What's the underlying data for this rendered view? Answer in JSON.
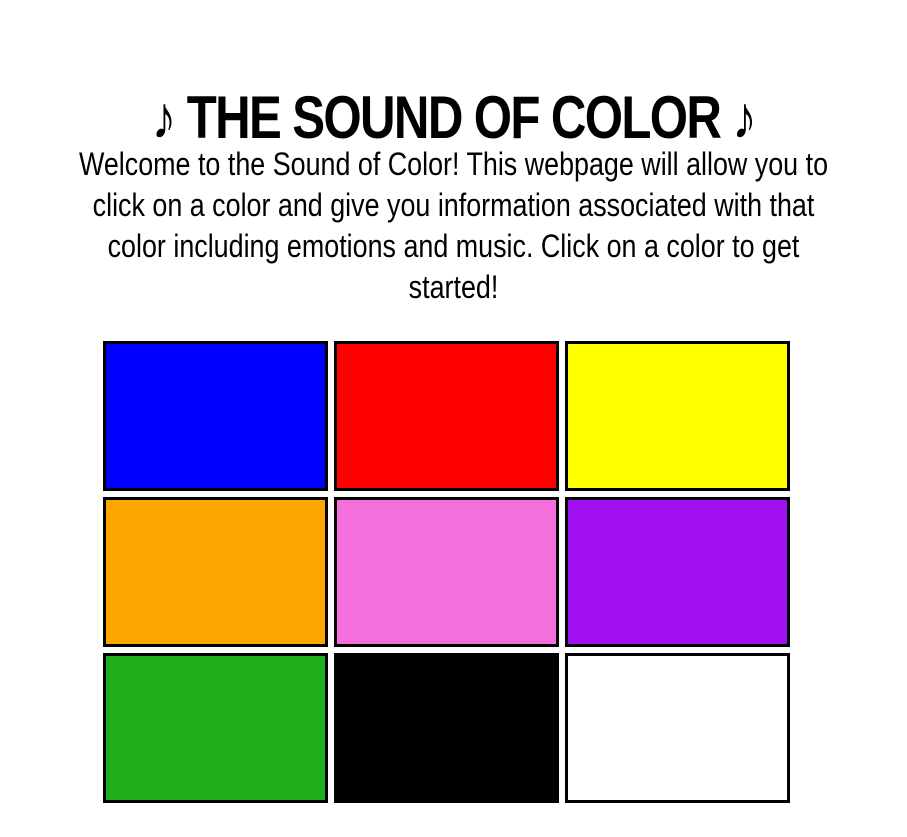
{
  "header": {
    "title": "♪ THE SOUND OF COLOR ♪"
  },
  "intro": {
    "text": "Welcome to the Sound of Color! This webpage will allow you to click on a color and give you information associated with that color including emotions and music. Click on a color to get started!"
  },
  "swatches": [
    {
      "color": "#0000ff"
    },
    {
      "color": "#ff0000"
    },
    {
      "color": "#ffff00"
    },
    {
      "color": "#ffa500"
    },
    {
      "color": "#f56fdc"
    },
    {
      "color": "#a010f0"
    },
    {
      "color": "#1faf1c"
    },
    {
      "color": "#000000"
    },
    {
      "color": "#ffffff"
    }
  ]
}
